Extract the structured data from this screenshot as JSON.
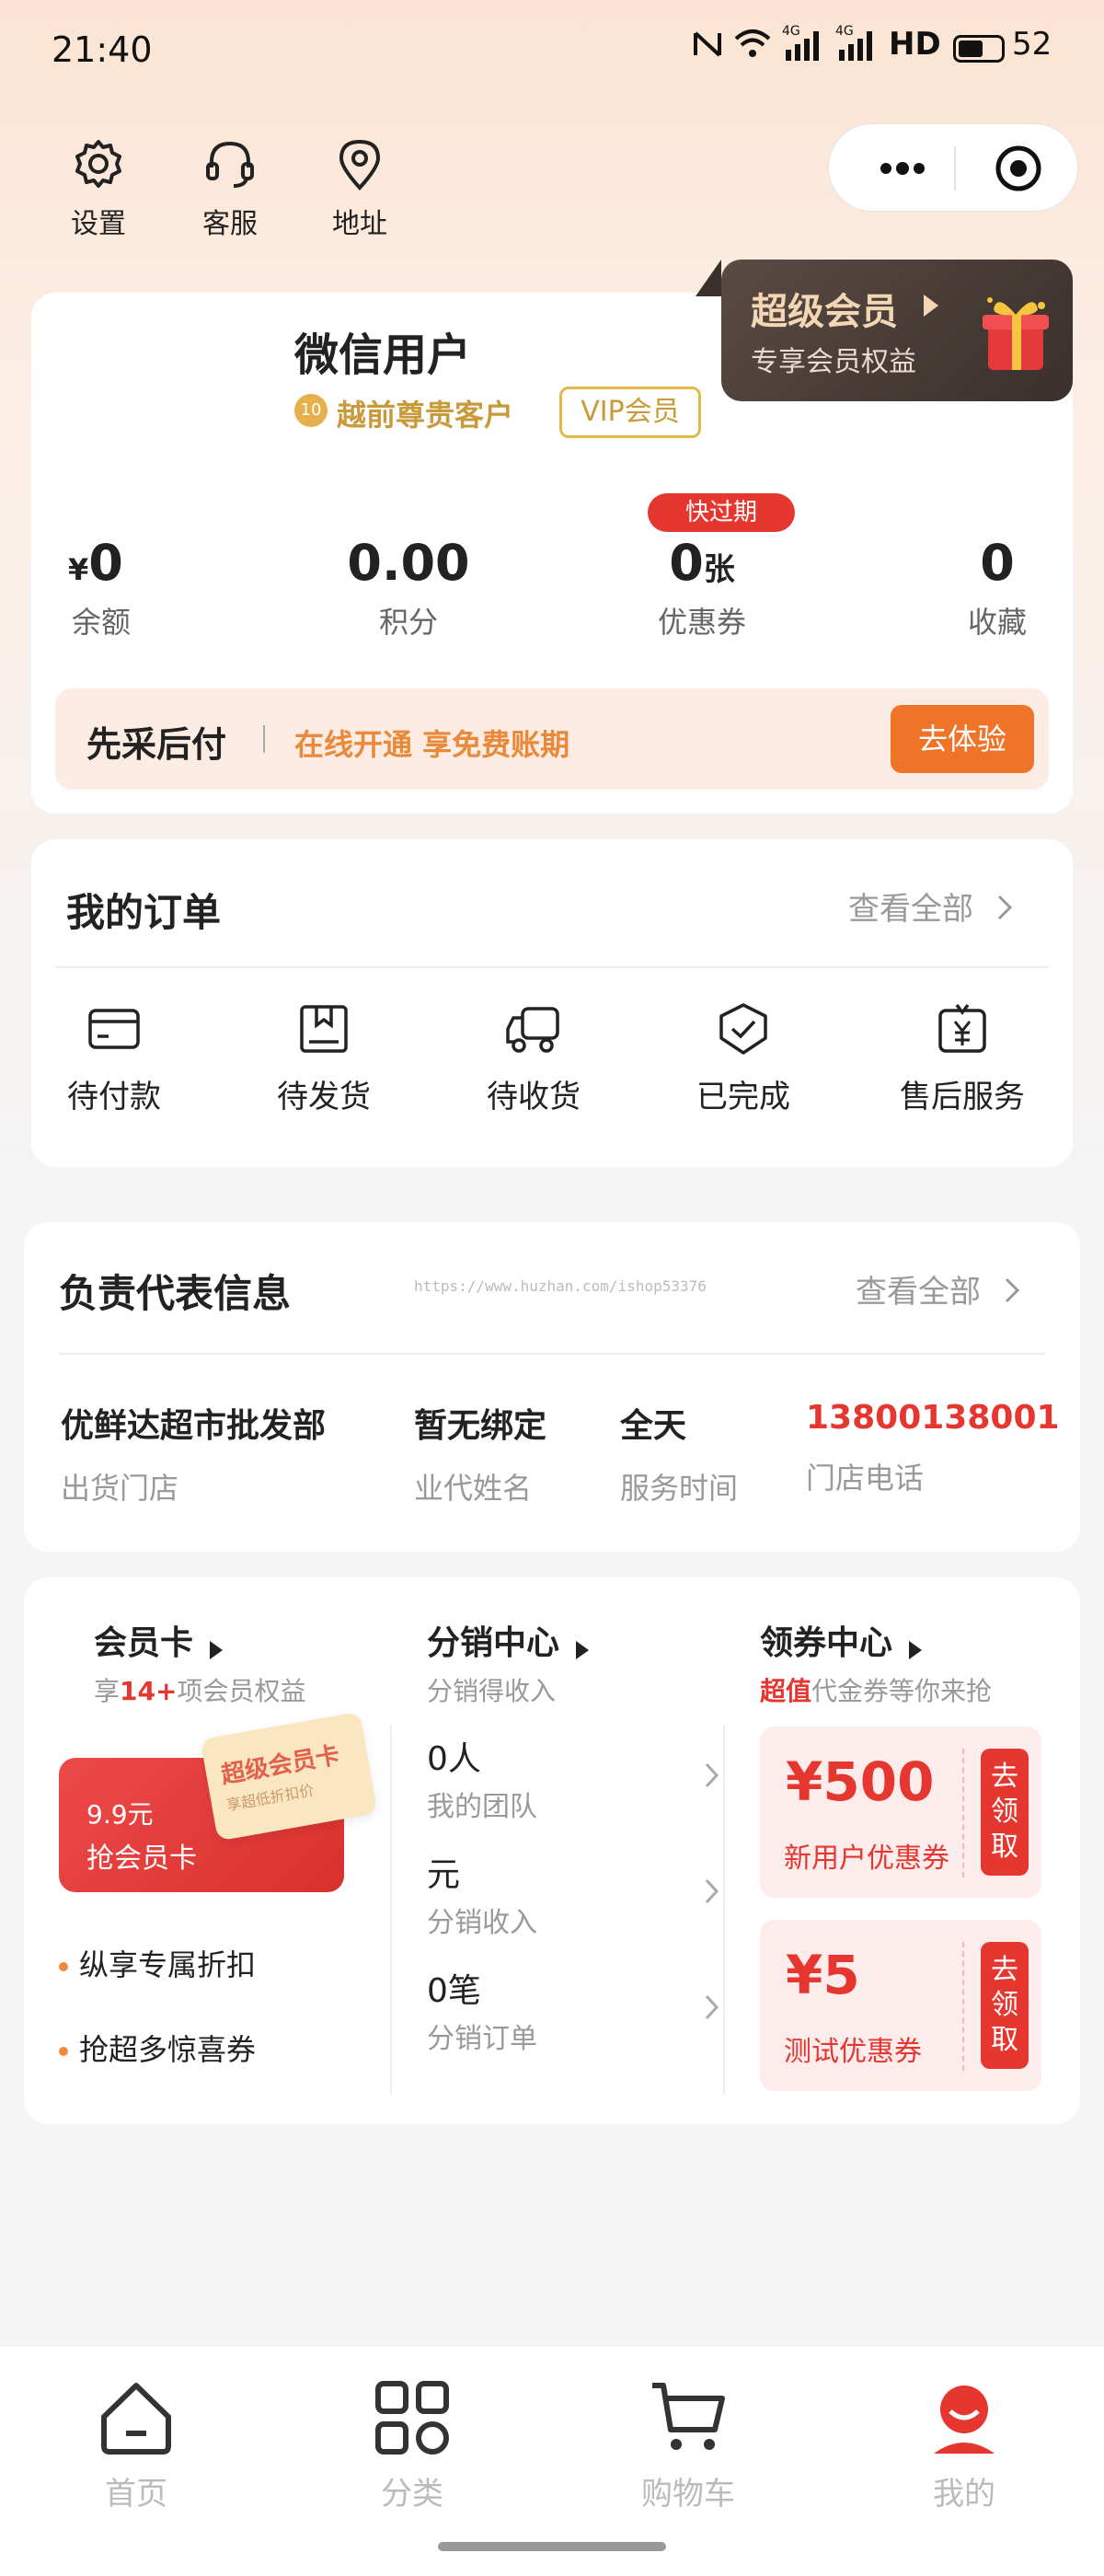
{
  "status_bar": {
    "time": "21:40",
    "signal1": "4G",
    "signal2": "4G",
    "hd": "HD",
    "battery": "52"
  },
  "top_nav": {
    "items": [
      {
        "label": "设置",
        "icon": "gear-icon"
      },
      {
        "label": "客服",
        "icon": "headset-icon"
      },
      {
        "label": "地址",
        "icon": "location-pin-icon"
      }
    ]
  },
  "capsule": {
    "more_icon": "more-dots-icon",
    "close_icon": "target-icon"
  },
  "super_vip": {
    "title": "超级会员",
    "subtitle": "专享会员权益"
  },
  "profile": {
    "name": "微信用户",
    "level": "越前尊贵客户",
    "badge": "VIP会员"
  },
  "stats": {
    "balance": {
      "currency": "¥",
      "value": "0",
      "label": "余额"
    },
    "points": {
      "value": "0.00",
      "label": "积分"
    },
    "coupons": {
      "value": "0",
      "unit": "张",
      "label": "优惠券",
      "tag": "快过期"
    },
    "favorites": {
      "value": "0",
      "label": "收藏"
    }
  },
  "pay_later": {
    "title": "先采后付",
    "text": "在线开通 享免费账期",
    "button": "去体验"
  },
  "orders": {
    "title": "我的订单",
    "view_all": "查看全部",
    "items": [
      {
        "label": "待付款",
        "icon": "card-icon"
      },
      {
        "label": "待发货",
        "icon": "package-icon"
      },
      {
        "label": "待收货",
        "icon": "truck-icon"
      },
      {
        "label": "已完成",
        "icon": "check-shield-icon"
      },
      {
        "label": "售后服务",
        "icon": "refund-icon"
      }
    ]
  },
  "rep": {
    "title": "负责代表信息",
    "watermark": "https://www.huzhan.com/ishop53376",
    "view_all": "查看全部",
    "fields": [
      {
        "value": "优鲜达超市批发部",
        "label": "出货门店"
      },
      {
        "value": "暂无绑定",
        "label": "业代姓名"
      },
      {
        "value": "全天",
        "label": "服务时间"
      },
      {
        "value": "13800138001",
        "label": "门店电话"
      }
    ]
  },
  "member_card": {
    "title": "会员卡",
    "sub_prefix": "享",
    "sub_highlight": "14+",
    "sub_suffix": "项会员权益",
    "card_price": "9.9元",
    "card_action": "抢会员卡",
    "card_stamp": "超级会员卡",
    "card_stamp_sub": "享超低折扣价",
    "benefits": [
      "纵享专属折扣",
      "抢超多惊喜券"
    ]
  },
  "distribution": {
    "title": "分销中心",
    "subtitle": "分销得收入",
    "rows": [
      {
        "value": "0人",
        "label": "我的团队"
      },
      {
        "value": "元",
        "label": "分销收入"
      },
      {
        "value": "0笔",
        "label": "分销订单"
      }
    ]
  },
  "coupon_center": {
    "title": "领券中心",
    "sub_highlight": "超值",
    "sub_rest": "代金券等你来抢",
    "coupons": [
      {
        "amount": "¥500",
        "name": "新用户优惠券",
        "action": "去领取"
      },
      {
        "amount": "¥5",
        "name": "测试优惠券",
        "action": "去领取"
      }
    ]
  },
  "tabbar": {
    "items": [
      {
        "label": "首页",
        "icon": "home-icon"
      },
      {
        "label": "分类",
        "icon": "category-grid-icon"
      },
      {
        "label": "购物车",
        "icon": "cart-icon"
      },
      {
        "label": "我的",
        "icon": "profile-icon"
      }
    ],
    "active_color": "#e5372f"
  },
  "colors": {
    "accent": "#e5372f",
    "orange": "#f07428",
    "gold": "#c99a3a"
  }
}
